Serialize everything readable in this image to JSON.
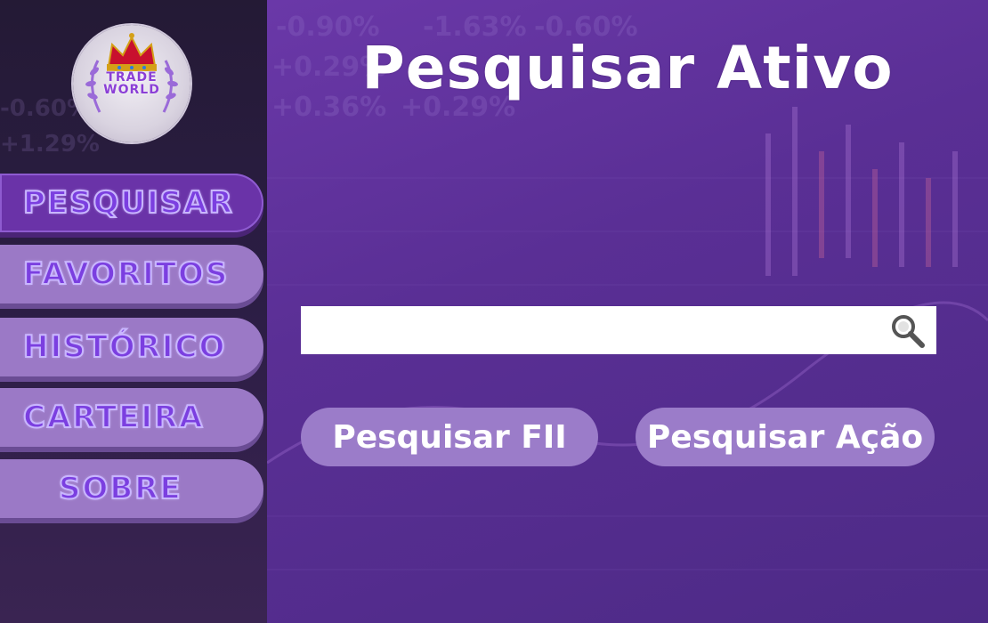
{
  "logo": {
    "line1": "TRADE",
    "line2": "WORLD"
  },
  "sidebar": {
    "items": [
      {
        "label": "PESQUISAR"
      },
      {
        "label": "FAVORITOS"
      },
      {
        "label": "HISTÓRICO"
      },
      {
        "label": "CARTEIRA"
      },
      {
        "label": "SOBRE"
      }
    ]
  },
  "main": {
    "title": "Pesquisar Ativo",
    "search": {
      "value": "",
      "placeholder": "",
      "icon": "search-icon"
    },
    "buttons": {
      "fii_label": "Pesquisar FII",
      "acao_label": "Pesquisar Ação"
    }
  },
  "background": {
    "ticker_percentages": [
      "-0.90%",
      "-1.63%",
      "-0.60%",
      "+0.29%",
      "+0.36%",
      "+0.29%"
    ]
  },
  "colors": {
    "sidebar_bg": "#2b1d44",
    "main_bg": "#5a2f95",
    "menu_button": "#9b79c6",
    "menu_active": "#6a33a8",
    "menu_text": "#7b3fe0",
    "action_button": "#9b7cc9",
    "title_text": "#ffffff"
  }
}
